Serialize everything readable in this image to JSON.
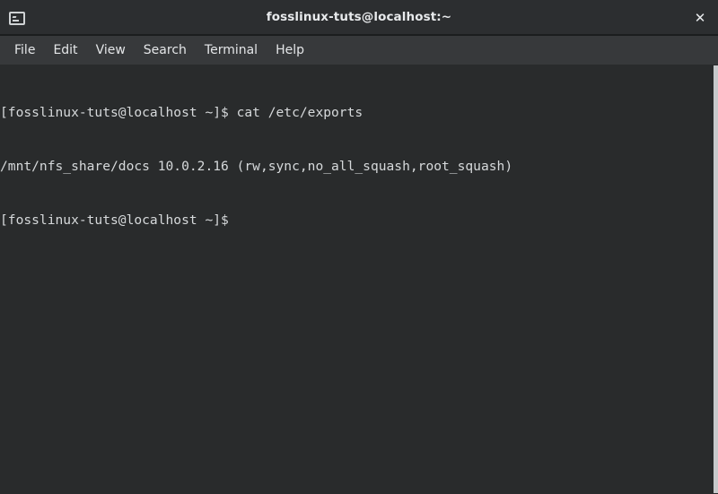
{
  "window": {
    "title": "fosslinux-tuts@localhost:~",
    "icon_name": "terminal-icon",
    "close_label": "✕",
    "colors": {
      "titlebar_bg": "#2c2e30",
      "menubar_bg": "#37393b",
      "terminal_bg": "#292b2c",
      "terminal_fg": "#d6d9db",
      "scrollbar": "#c6c9cb"
    }
  },
  "menubar": {
    "items": [
      {
        "label": "File"
      },
      {
        "label": "Edit"
      },
      {
        "label": "View"
      },
      {
        "label": "Search"
      },
      {
        "label": "Terminal"
      },
      {
        "label": "Help"
      }
    ]
  },
  "terminal": {
    "lines": [
      "[fosslinux-tuts@localhost ~]$ cat /etc/exports",
      "/mnt/nfs_share/docs 10.0.2.16 (rw,sync,no_all_squash,root_squash)",
      "[fosslinux-tuts@localhost ~]$"
    ],
    "prompt": "[fosslinux-tuts@localhost ~]$",
    "command": "cat /etc/exports",
    "output": "/mnt/nfs_share/docs 10.0.2.16 (rw,sync,no_all_squash,root_squash)"
  }
}
